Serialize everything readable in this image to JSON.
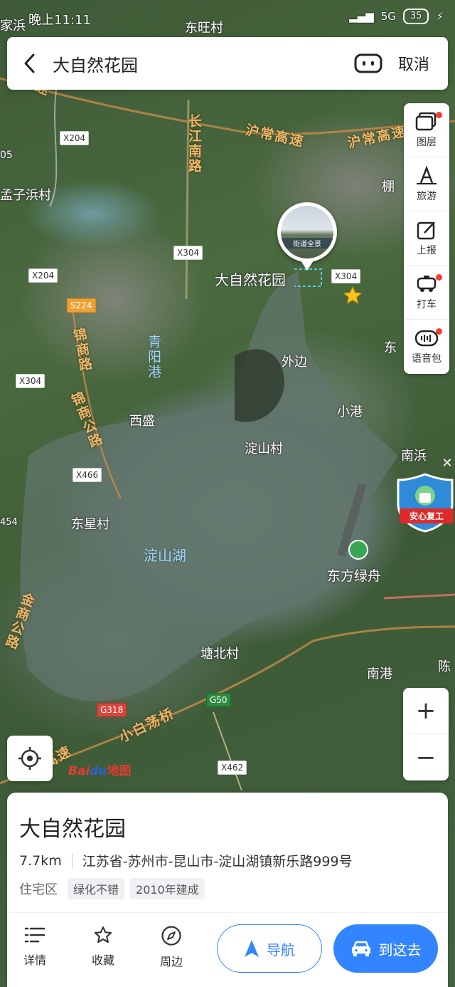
{
  "status_bar": {
    "time": "晚上11:11",
    "network": "5G",
    "battery": "35"
  },
  "search": {
    "query": "大自然花园",
    "cancel_label": "取消"
  },
  "tools": [
    {
      "label": "图层",
      "icon": "layers-icon",
      "badge": true
    },
    {
      "label": "旅游",
      "icon": "travel-icon",
      "badge": false
    },
    {
      "label": "上报",
      "icon": "report-icon",
      "badge": false
    },
    {
      "label": "打车",
      "icon": "taxi-icon",
      "badge": true
    },
    {
      "label": "语音包",
      "icon": "voice-pack-icon",
      "badge": true
    }
  ],
  "map": {
    "marker_label": "大自然花园",
    "streetview_label": "街道全景",
    "places": {
      "dongwang": "东旺村",
      "jiabang": "家浜",
      "mengzibang": "孟子浜村",
      "waibian": "外边",
      "xisheng": "西盛",
      "dianshancun": "淀山村",
      "xiaogang": "小港",
      "nanbang": "南浜",
      "dongxing": "东星村",
      "dianshanhu": "淀山湖",
      "dongfanglvzhou": "东方绿舟",
      "tangbeicun": "塘北村",
      "nangang": "南港",
      "qingyanggang": "青阳港",
      "dong_edge": "东",
      "chen_edge": "陈",
      "peng_edge": "棚",
      "num_05": "05",
      "num_454": "454"
    },
    "roads": {
      "hushang1": "沪常高速",
      "hushang2": "沪常高速",
      "hugao": "沪高速",
      "changjiang": "长江南路",
      "jinshang": "锦商路",
      "jinshanggong": "锦商公路",
      "jingong": "金商公路",
      "xiaobai": "小白荡桥",
      "yugao": "渝高速"
    },
    "badges": {
      "x204_a": "X204",
      "x204_b": "X204",
      "x304_a": "X304",
      "x304_b": "X304",
      "x304_c": "X304",
      "s224": "S224",
      "x466": "X466",
      "g318": "G318",
      "g50": "G50",
      "x462": "X462"
    },
    "promo_label": "安心复工",
    "logo": {
      "bai": "Bai",
      "du": "du",
      "map": "地图"
    }
  },
  "card": {
    "name": "大自然花园",
    "distance": "7.7km",
    "address": "江苏省-苏州市-昆山市-淀山湖镇新乐路999号",
    "category": "住宅区",
    "tags": [
      "绿化不错",
      "2010年建成"
    ],
    "actions": {
      "detail": "详情",
      "favorite": "收藏",
      "nearby": "周边"
    },
    "nav_label": "导航",
    "go_label": "到这去"
  },
  "colors": {
    "accent": "#3385ff",
    "badge_red": "#f23d2e"
  }
}
